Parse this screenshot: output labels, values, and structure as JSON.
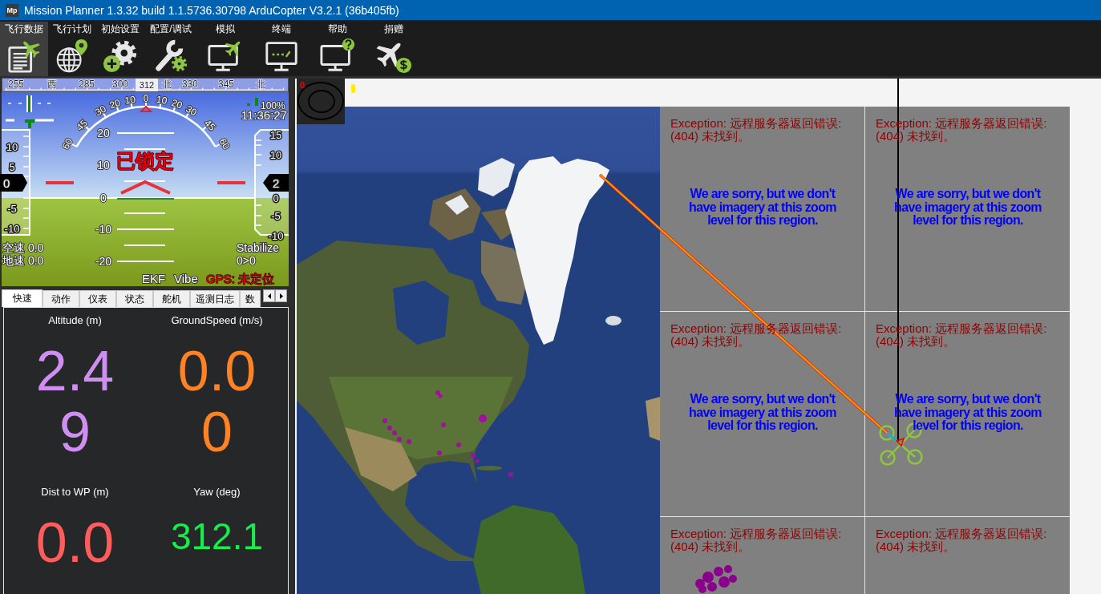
{
  "window": {
    "logo": "Mp",
    "title": "Mission Planner 1.3.32 build 1.1.5736.30798 ArduCopter V3.2.1 (36b405fb)"
  },
  "toolbar": [
    {
      "label": "飞行数据",
      "kind": "data",
      "selected": true
    },
    {
      "label": "飞行计划",
      "kind": "plan",
      "selected": false
    },
    {
      "label": "初始设置",
      "kind": "setup",
      "selected": false
    },
    {
      "label": "配置/调试",
      "kind": "config",
      "selected": false
    },
    {
      "label": "模拟",
      "kind": "simulation",
      "selected": false
    },
    {
      "label": "终端",
      "kind": "terminal",
      "selected": false
    },
    {
      "label": "帮助",
      "kind": "help",
      "selected": false
    },
    {
      "label": "捐赠",
      "kind": "donate",
      "selected": false
    }
  ],
  "hud": {
    "heading_tape": [
      "255",
      "西",
      "285",
      "300",
      "北",
      "330",
      "345",
      "北"
    ],
    "heading": "312",
    "roll_scale": [
      "60",
      "45",
      "30",
      "20",
      "10",
      "0",
      "10",
      "20",
      "30",
      "45",
      "60"
    ],
    "pitch_scale": [
      "20",
      "10",
      "0",
      "-10",
      "-20"
    ],
    "status": "已锁定",
    "speed_tape": [
      "10",
      "5",
      "-5",
      "-10"
    ],
    "speed": "0",
    "altitude_tape": [
      "15",
      "10",
      "0",
      "-5",
      "-10"
    ],
    "altitude": "2",
    "battery": "100%",
    "time": "11:36:27",
    "airspeed": "空速 0.0",
    "groundspeed": "地速 0.0",
    "mode": "Stabilize",
    "waypoint": "0>0",
    "indicators": [
      {
        "label": "EKF",
        "warning": false
      },
      {
        "label": "Vibe",
        "warning": false
      },
      {
        "label": "GPS: 未定位",
        "warning": true
      }
    ]
  },
  "tabs": [
    {
      "label": "快速",
      "selected": true
    },
    {
      "label": "动作",
      "selected": false
    },
    {
      "label": "仪表",
      "selected": false
    },
    {
      "label": "状态",
      "selected": false
    },
    {
      "label": "舵机",
      "selected": false
    },
    {
      "label": "遥测日志",
      "selected": false
    },
    {
      "label": "数",
      "selected": false
    }
  ],
  "quick": [
    {
      "label": "Altitude (m)",
      "value": "2.49",
      "color": "#d18ef2"
    },
    {
      "label": "GroundSpeed (m/s)",
      "value": "0.00",
      "color": "#ff8224"
    },
    {
      "label": "Dist to WP (m)",
      "value": "0.0",
      "color": "#ff5c5c"
    },
    {
      "label": "Yaw (deg)",
      "value": "312.1",
      "color": "#14f04a"
    }
  ],
  "map": {
    "wind_speed": "0",
    "tiles": [
      {
        "error": "Exception: 远程服务器返回错误: (404) 未找到。",
        "message": "We are sorry, but we don't have imagery at this zoom level for this region."
      },
      {
        "error": "Exception: 远程服务器返回错误: (404) 未找到。",
        "message": "We are sorry, but we don't have imagery at this zoom level for this region."
      },
      {
        "error": "Exception: 远程服务器返回错误: (404) 未找到。",
        "message": "We are sorry, but we don't have imagery at this zoom level for this region."
      },
      {
        "error": "Exception: 远程服务器返回错误: (404) 未找到。",
        "message": "We are sorry, but we don't have imagery at this zoom level for this region."
      },
      {
        "error": "Exception: 远程服务器返回错误: (404) 未找到。"
      },
      {
        "error": "Exception: 远程服务器返回错误: (404) 未找到。"
      }
    ]
  }
}
